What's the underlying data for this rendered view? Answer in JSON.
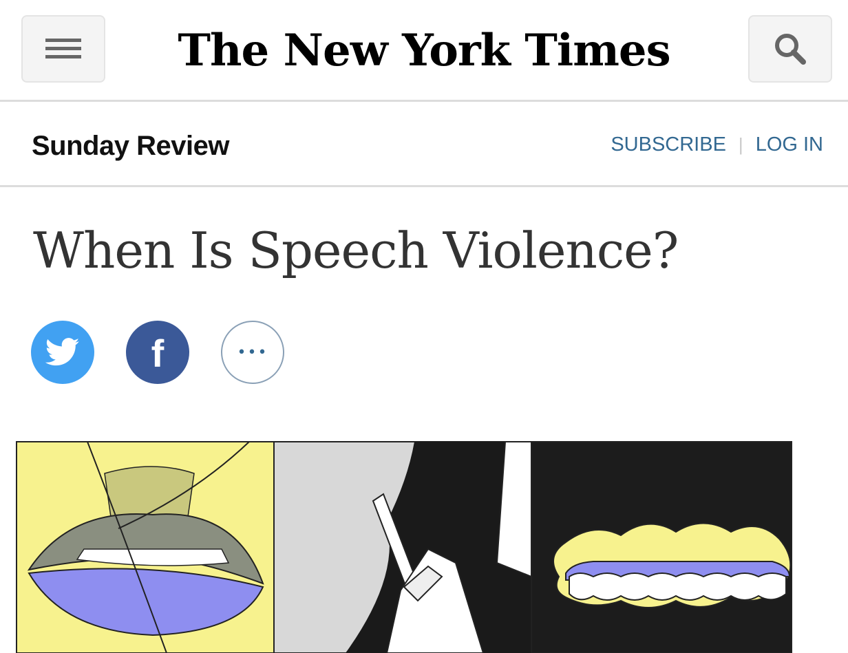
{
  "header": {
    "menu_icon": "hamburger-menu-icon",
    "masthead": "The New York Times",
    "search_icon": "search-icon"
  },
  "section": {
    "name": "Sunday Review",
    "subscribe_label": "SUBSCRIBE",
    "login_label": "LOG IN"
  },
  "article": {
    "headline": "When Is Speech Violence?"
  },
  "share": [
    {
      "icon": "twitter-icon"
    },
    {
      "icon": "facebook-icon",
      "glyph": "f"
    },
    {
      "icon": "more-options-icon",
      "glyph": "•••"
    }
  ],
  "colors": {
    "link": "#326891",
    "twitter": "#41a1f2",
    "facebook": "#3b5998",
    "illustration_yellow": "#f7f28e",
    "illustration_purple": "#8e8ef0",
    "illustration_olive": "#8a8f80"
  }
}
